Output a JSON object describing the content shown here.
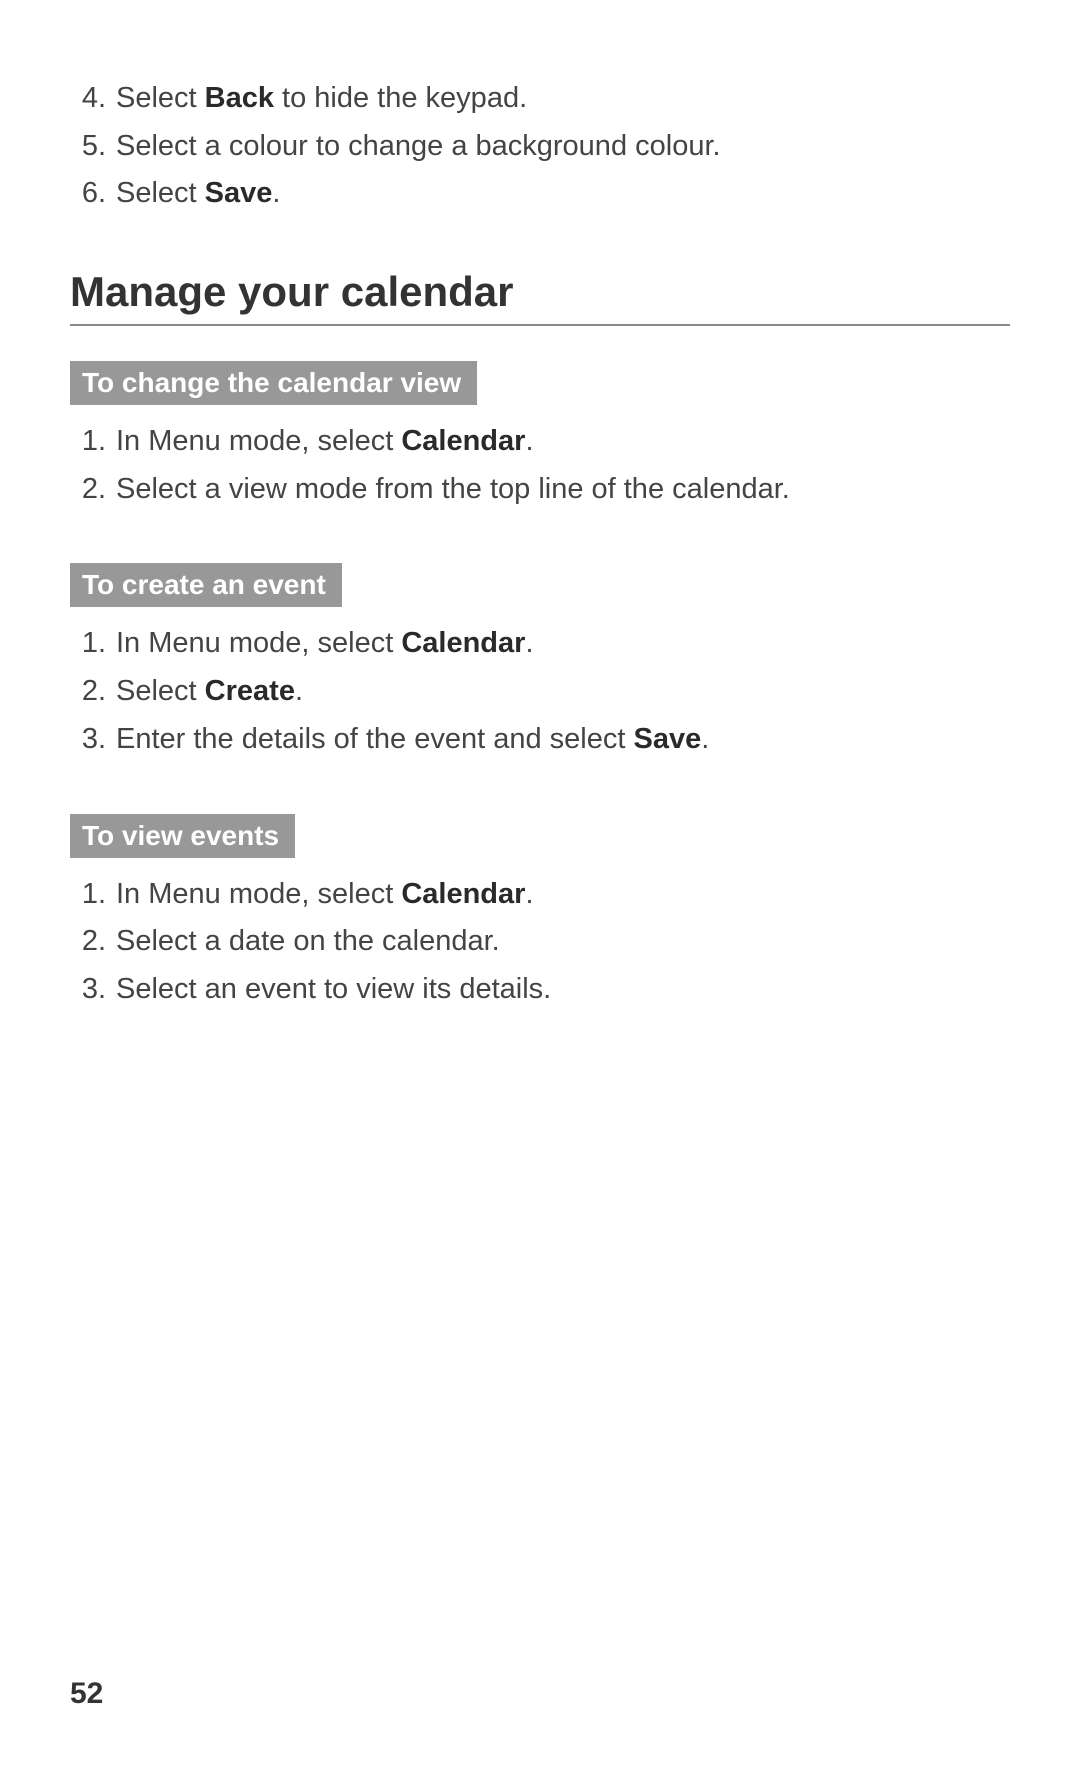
{
  "top_list": [
    {
      "num": "4.",
      "prefix": "Select ",
      "bold": "Back",
      "suffix": " to hide the keypad."
    },
    {
      "num": "5.",
      "prefix": "Select a colour to change a background colour.",
      "bold": "",
      "suffix": ""
    },
    {
      "num": "6.",
      "prefix": "Select ",
      "bold": "Save",
      "suffix": "."
    }
  ],
  "section_title": "Manage your calendar",
  "sub1": {
    "title": "To change the calendar view",
    "items": [
      {
        "num": "1.",
        "prefix": "In Menu mode, select ",
        "bold": "Calendar",
        "suffix": "."
      },
      {
        "num": "2.",
        "prefix": "Select a view mode from the top line of the calendar.",
        "bold": "",
        "suffix": ""
      }
    ]
  },
  "sub2": {
    "title": "To create an event",
    "items": [
      {
        "num": "1.",
        "prefix": "In Menu mode, select ",
        "bold": "Calendar",
        "suffix": "."
      },
      {
        "num": "2.",
        "prefix": "Select ",
        "bold": "Create",
        "suffix": "."
      },
      {
        "num": "3.",
        "prefix": "Enter the details of the event and select ",
        "bold": "Save",
        "suffix": "."
      }
    ]
  },
  "sub3": {
    "title": "To view events",
    "items": [
      {
        "num": "1.",
        "prefix": "In Menu mode, select ",
        "bold": "Calendar",
        "suffix": "."
      },
      {
        "num": "2.",
        "prefix": "Select a date on the calendar.",
        "bold": "",
        "suffix": ""
      },
      {
        "num": "3.",
        "prefix": "Select an event to view its details.",
        "bold": "",
        "suffix": ""
      }
    ]
  },
  "page_number": "52"
}
